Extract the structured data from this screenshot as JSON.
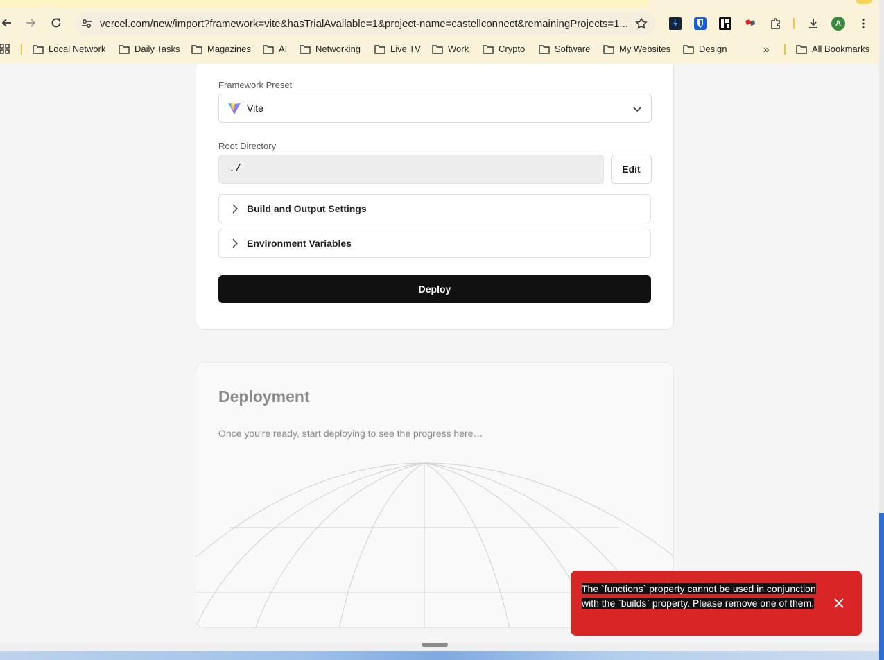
{
  "browser": {
    "url": "vercel.com/new/import?framework=vite&hasTrialAvailable=1&project-name=castellconnect&remainingProjects=1...",
    "avatar_letter": "A",
    "bookmarks": [
      {
        "label": "Local Network"
      },
      {
        "label": "Daily Tasks"
      },
      {
        "label": "Magazines"
      },
      {
        "label": "AI"
      },
      {
        "label": "Networking"
      },
      {
        "label": "Live TV"
      },
      {
        "label": "Work"
      },
      {
        "label": "Crypto"
      },
      {
        "label": "Software"
      },
      {
        "label": "My Websites"
      },
      {
        "label": "Design"
      }
    ],
    "more_bookmarks": "»",
    "all_bookmarks": "All Bookmarks"
  },
  "config": {
    "framework_label": "Framework Preset",
    "framework_value": "Vite",
    "root_label": "Root Directory",
    "root_value": "./",
    "edit_label": "Edit",
    "build_settings_label": "Build and Output Settings",
    "env_vars_label": "Environment Variables",
    "deploy_label": "Deploy"
  },
  "deployment": {
    "title": "Deployment",
    "description": "Once you're ready, start deploying to see the progress here…"
  },
  "toast": {
    "message": "The `functions` property cannot be used in conjunction with the `builds` property. Please remove one of them.",
    "color": "#d92525"
  }
}
